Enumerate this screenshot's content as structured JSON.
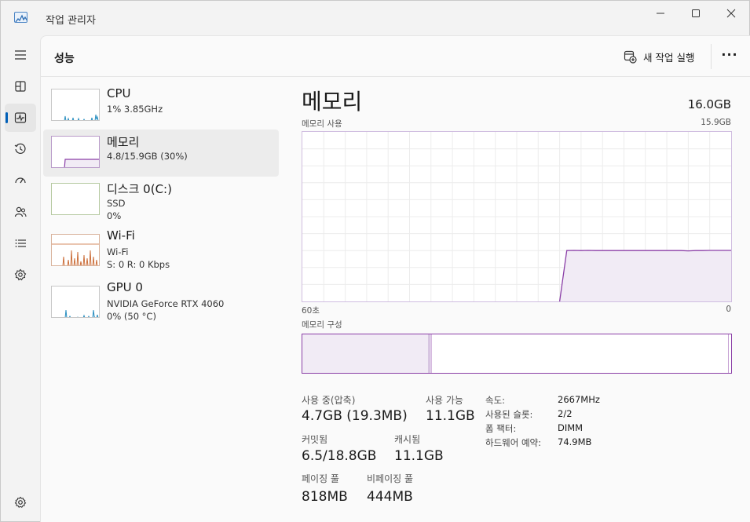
{
  "app": {
    "title": "작업 관리자"
  },
  "page": {
    "title": "성능"
  },
  "toolbar": {
    "run_task_label": "새 작업 실행",
    "more_label": "···"
  },
  "resources": [
    {
      "name": "CPU",
      "line1": "1% 3.85GHz",
      "line2": ""
    },
    {
      "name": "메모리",
      "line1": "4.8/15.9GB (30%)",
      "line2": ""
    },
    {
      "name": "디스크 0(C:)",
      "line1": "SSD",
      "line2": "0%"
    },
    {
      "name": "Wi-Fi",
      "line1": "Wi-Fi",
      "line2": "S: 0 R: 0 Kbps"
    },
    {
      "name": "GPU 0",
      "line1": "NVIDIA GeForce RTX 4060",
      "line2": "0% (50 °C)"
    }
  ],
  "memory": {
    "title": "메모리",
    "total": "16.0GB",
    "usage_label": "메모리 사용",
    "usage_max": "15.9GB",
    "time_start": "60초",
    "time_end": "0",
    "composition_label": "메모리 구성",
    "composition": {
      "in_use_fraction": 0.295,
      "modified_fraction": 0.006,
      "standby_fraction": 0.693,
      "free_fraction": 0.006
    },
    "usage_series": [
      0,
      0,
      0,
      0,
      0,
      0,
      0,
      0,
      0,
      0,
      0,
      0,
      0,
      0,
      0,
      0,
      0,
      0,
      0,
      0,
      0,
      0,
      0,
      0,
      0,
      0,
      0,
      0,
      0,
      0,
      0,
      0,
      0,
      0,
      0,
      0,
      0,
      0.3,
      0.301,
      0.3,
      0.301,
      0.3,
      0.3,
      0.3,
      0.3,
      0.3,
      0.3,
      0.3,
      0.3,
      0.3,
      0.3,
      0.3,
      0.3,
      0.3,
      0.298,
      0.3,
      0.3,
      0.301,
      0.301,
      0.301,
      0.301
    ]
  },
  "stats": {
    "in_use_label": "사용 중(압축)",
    "in_use_value": "4.7GB (19.3MB)",
    "available_label": "사용 가능",
    "available_value": "11.1GB",
    "committed_label": "커밋됨",
    "committed_value": "6.5/18.8GB",
    "cached_label": "캐시됨",
    "cached_value": "11.1GB",
    "paged_label": "페이징 풀",
    "paged_value": "818MB",
    "nonpaged_label": "비페이징 풀",
    "nonpaged_value": "444MB"
  },
  "info": {
    "speed_label": "속도:",
    "speed_value": "2667MHz",
    "slots_label": "사용된 슬롯:",
    "slots_value": "2/2",
    "form_label": "폼 팩터:",
    "form_value": "DIMM",
    "reserved_label": "하드웨어 예약:",
    "reserved_value": "74.9MB"
  },
  "colors": {
    "memory": "#8b3fa7",
    "memory_fill": "#f1ebf5",
    "cpu": "#2a8fc0",
    "wifi": "#c8642c",
    "accent": "#005fb8"
  },
  "icons": [
    "hamburger-icon",
    "processes-icon",
    "performance-icon",
    "app-history-icon",
    "startup-apps-icon",
    "users-icon",
    "details-icon",
    "services-icon",
    "settings-icon"
  ]
}
